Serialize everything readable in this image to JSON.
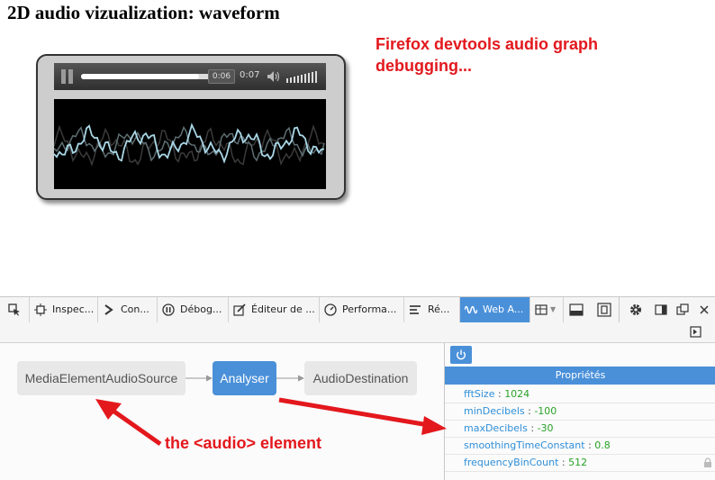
{
  "page": {
    "title": "2D audio vizualization: waveform",
    "note_devtools": "Firefox devtools audio graph debugging...",
    "note_audio": "the <audio> element"
  },
  "player": {
    "tooltip": "0:06",
    "time": "0:07",
    "progress_fraction": 0.78
  },
  "toolbar": {
    "tabs": [
      {
        "name": "inspector",
        "label": "Inspec..."
      },
      {
        "name": "console",
        "label": "Con..."
      },
      {
        "name": "debugger",
        "label": "Débog..."
      },
      {
        "name": "style-editor",
        "label": "Éditeur de ..."
      },
      {
        "name": "performance",
        "label": "Performa..."
      },
      {
        "name": "network",
        "label": "Ré..."
      },
      {
        "name": "web-audio",
        "label": "Web A..."
      }
    ],
    "active_tab": "Web A..."
  },
  "graph": {
    "nodes": [
      "MediaElementAudioSource",
      "Analyser",
      "AudioDestination"
    ]
  },
  "properties": {
    "header": "Propriétés",
    "rows": [
      {
        "key": "fftSize",
        "value": "1024"
      },
      {
        "key": "minDecibels",
        "value": "-100"
      },
      {
        "key": "maxDecibels",
        "value": "-30"
      },
      {
        "key": "smoothingTimeConstant",
        "value": "0.8"
      },
      {
        "key": "frequencyBinCount",
        "value": "512"
      }
    ]
  },
  "colors": {
    "accent": "#4a90d9",
    "annotation_red": "#e3181d",
    "prop_key": "#2f8fd8",
    "prop_value": "#28a228"
  }
}
